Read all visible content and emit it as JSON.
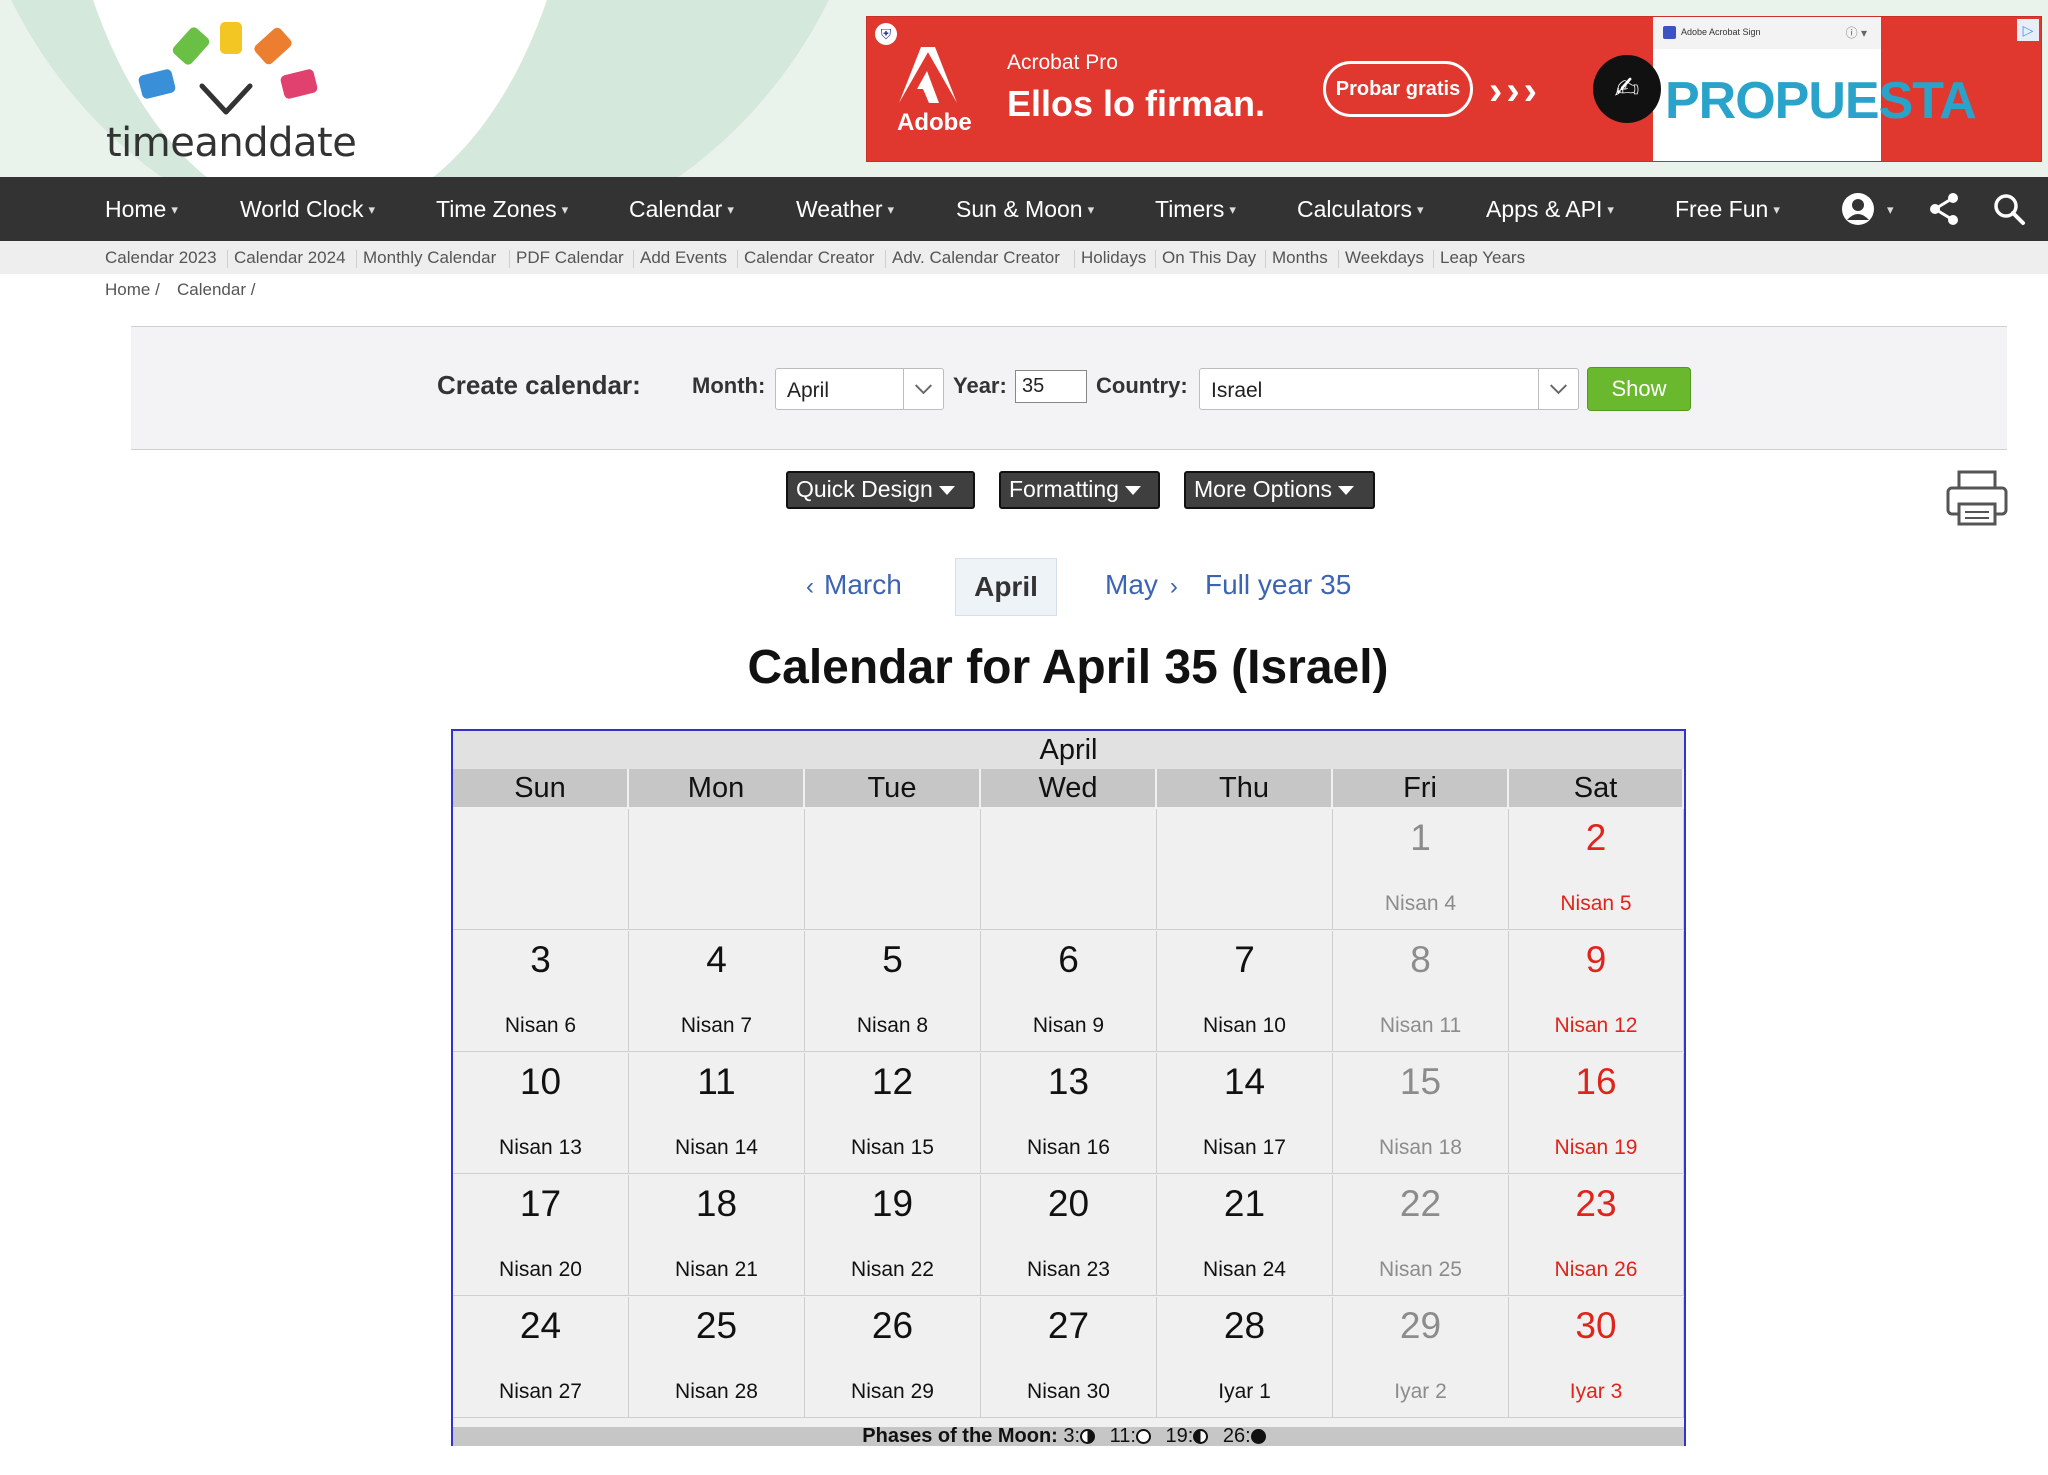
{
  "header": {
    "logo_text": "timeanddate",
    "logo_colors": [
      "#6abf45",
      "#f3c623",
      "#ec7f2f",
      "#3a8fd9",
      "#e0416e"
    ]
  },
  "ad": {
    "brand": "Adobe",
    "product": "Acrobat Pro",
    "headline": "Ellos lo firman.",
    "cta": "Probar gratis",
    "chevrons": "›››",
    "doc_header": "Adobe Acrobat Sign",
    "doc_word": "PROPUESTA",
    "bg_color": "#e0372f"
  },
  "nav": {
    "items": [
      "Home",
      "World Clock",
      "Time Zones",
      "Calendar",
      "Weather",
      "Sun & Moon",
      "Timers",
      "Calculators",
      "Apps & API",
      "Free Fun"
    ],
    "icons": [
      "account-icon",
      "share-icon",
      "search-icon"
    ]
  },
  "subnav": {
    "items": [
      "Calendar 2023",
      "Calendar 2024",
      "Monthly Calendar",
      "PDF Calendar",
      "Add Events",
      "Calendar Creator",
      "Adv. Calendar Creator",
      "Holidays",
      "On This Day",
      "Months",
      "Weekdays",
      "Leap Years"
    ]
  },
  "breadcrumb": {
    "items": [
      "Home /",
      "Calendar /"
    ]
  },
  "create": {
    "label": "Create calendar:",
    "month_label": "Month:",
    "month_value": "April",
    "year_label": "Year:",
    "year_value": "35",
    "country_label": "Country:",
    "country_value": "Israel",
    "show_label": "Show",
    "show_color": "#6ab82e"
  },
  "options": {
    "buttons": [
      "Quick Design",
      "Formatting",
      "More Options"
    ]
  },
  "month_nav": {
    "prev": "March",
    "current": "April",
    "next": "May",
    "full_year": "Full year 35"
  },
  "title": "Calendar for April 35 (Israel)",
  "calendar": {
    "month": "April",
    "weekdays": [
      "Sun",
      "Mon",
      "Tue",
      "Wed",
      "Thu",
      "Fri",
      "Sat"
    ],
    "colors": {
      "friday": "#8c8c8c",
      "saturday": "#e0241b",
      "border": "#3333cc"
    },
    "weeks": [
      [
        null,
        null,
        null,
        null,
        null,
        {
          "day": "1",
          "heb": "Nisan 4"
        },
        {
          "day": "2",
          "heb": "Nisan 5"
        }
      ],
      [
        {
          "day": "3",
          "heb": "Nisan 6"
        },
        {
          "day": "4",
          "heb": "Nisan 7"
        },
        {
          "day": "5",
          "heb": "Nisan 8"
        },
        {
          "day": "6",
          "heb": "Nisan 9"
        },
        {
          "day": "7",
          "heb": "Nisan 10"
        },
        {
          "day": "8",
          "heb": "Nisan 11"
        },
        {
          "day": "9",
          "heb": "Nisan 12"
        }
      ],
      [
        {
          "day": "10",
          "heb": "Nisan 13"
        },
        {
          "day": "11",
          "heb": "Nisan 14"
        },
        {
          "day": "12",
          "heb": "Nisan 15"
        },
        {
          "day": "13",
          "heb": "Nisan 16"
        },
        {
          "day": "14",
          "heb": "Nisan 17"
        },
        {
          "day": "15",
          "heb": "Nisan 18"
        },
        {
          "day": "16",
          "heb": "Nisan 19"
        }
      ],
      [
        {
          "day": "17",
          "heb": "Nisan 20"
        },
        {
          "day": "18",
          "heb": "Nisan 21"
        },
        {
          "day": "19",
          "heb": "Nisan 22"
        },
        {
          "day": "20",
          "heb": "Nisan 23"
        },
        {
          "day": "21",
          "heb": "Nisan 24"
        },
        {
          "day": "22",
          "heb": "Nisan 25"
        },
        {
          "day": "23",
          "heb": "Nisan 26"
        }
      ],
      [
        {
          "day": "24",
          "heb": "Nisan 27"
        },
        {
          "day": "25",
          "heb": "Nisan 28"
        },
        {
          "day": "26",
          "heb": "Nisan 29"
        },
        {
          "day": "27",
          "heb": "Nisan 30"
        },
        {
          "day": "28",
          "heb": "Iyar 1"
        },
        {
          "day": "29",
          "heb": "Iyar 2"
        },
        {
          "day": "30",
          "heb": "Iyar 3"
        }
      ]
    ],
    "moon_label": "Phases of the Moon:",
    "moon_phases": [
      {
        "day": "3:",
        "phase": "first-quarter"
      },
      {
        "day": "11:",
        "phase": "full-moon"
      },
      {
        "day": "19:",
        "phase": "third-quarter"
      },
      {
        "day": "26:",
        "phase": "new-moon"
      }
    ]
  }
}
